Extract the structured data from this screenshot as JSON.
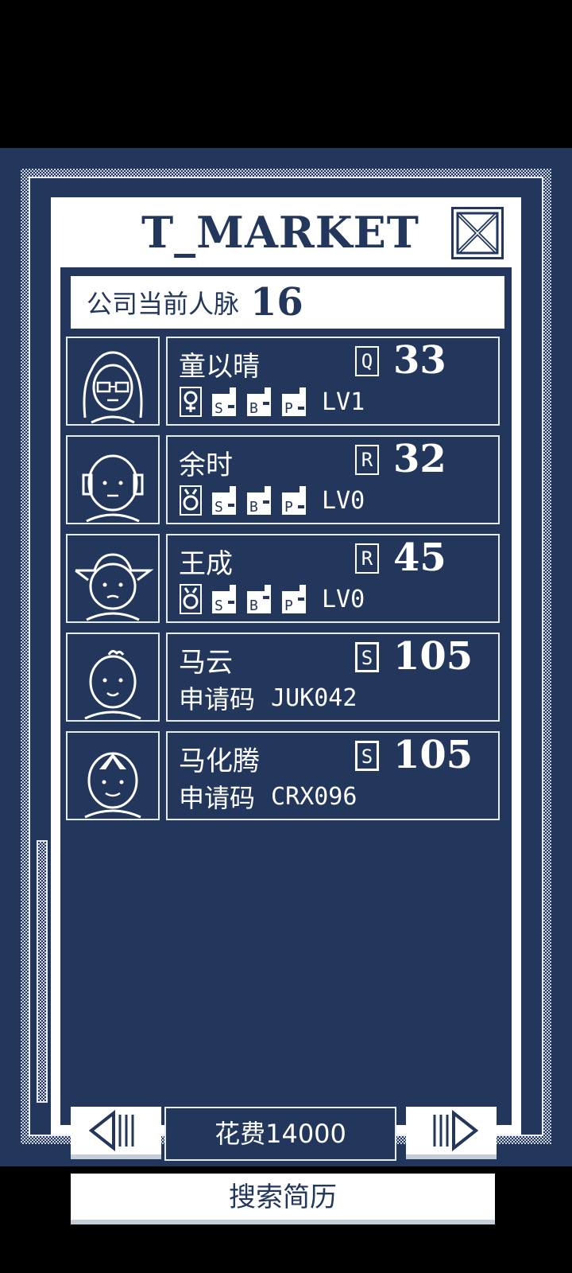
{
  "title": "T_MARKET",
  "network": {
    "label": "公司当前人脉",
    "value": "16"
  },
  "candidates": [
    {
      "name": "童以晴",
      "rank": "Q",
      "score": "33",
      "gender": "female",
      "skills": [
        "S",
        "B",
        "P"
      ],
      "level": "LV1"
    },
    {
      "name": "余时",
      "rank": "R",
      "score": "32",
      "gender": "male",
      "skills": [
        "S",
        "B",
        "P"
      ],
      "level": "LV0"
    },
    {
      "name": "王成",
      "rank": "R",
      "score": "45",
      "gender": "male",
      "skills": [
        "S",
        "B",
        "P"
      ],
      "level": "LV0"
    },
    {
      "name": "马云",
      "rank": "S",
      "score": "105",
      "code_label": "申请码",
      "code": "JUK042"
    },
    {
      "name": "马化腾",
      "rank": "S",
      "score": "105",
      "code_label": "申请码",
      "code": "CRX096"
    }
  ],
  "footer": {
    "cost": "花费14000",
    "search": "搜索简历"
  },
  "icons": {
    "close": "close-x-icon",
    "prev": "prev-page-icon",
    "next": "next-page-icon"
  },
  "colors": {
    "navy": "#23375d",
    "white": "#ffffff",
    "dither": "#c9d0da"
  }
}
